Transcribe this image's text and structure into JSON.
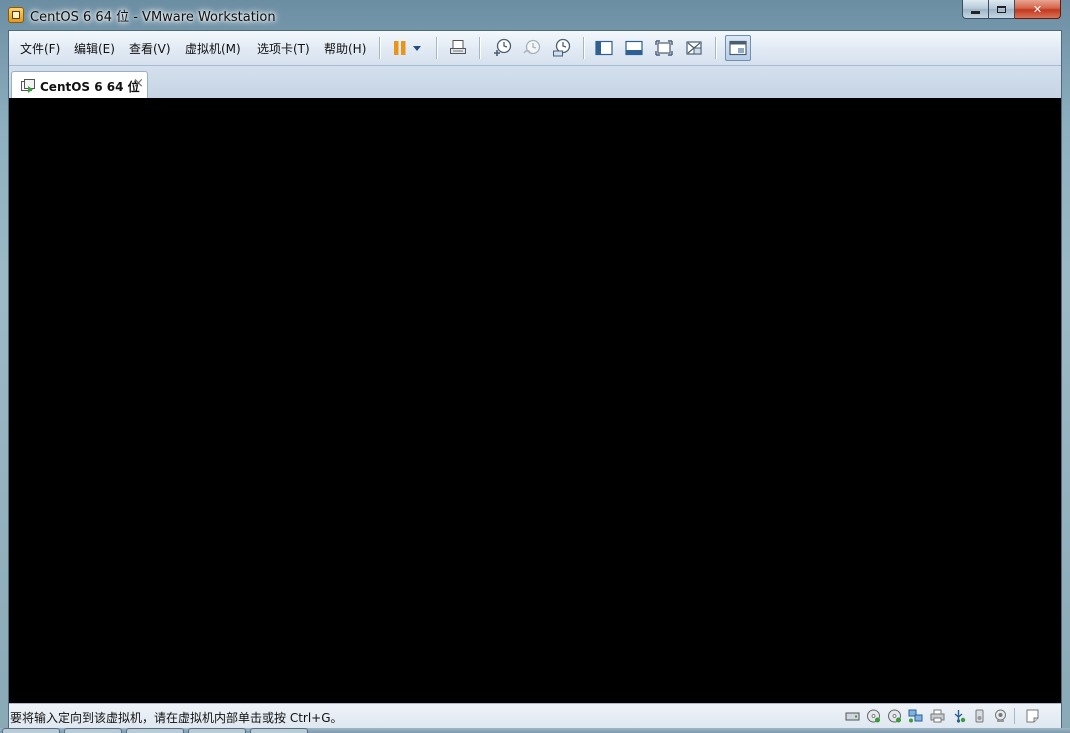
{
  "window": {
    "title": "CentOS 6 64 位 - VMware Workstation",
    "caption_buttons": [
      "minimize-icon",
      "maximize-icon",
      "close-icon"
    ],
    "close_glyph": "✕"
  },
  "menubar": {
    "items": [
      {
        "label": "文件(F)"
      },
      {
        "label": "编辑(E)"
      },
      {
        "label": "查看(V)"
      },
      {
        "label": "虚拟机(M)"
      },
      {
        "label": "选项卡(T)"
      },
      {
        "label": "帮助(H)"
      }
    ]
  },
  "toolbar": {
    "buttons": [
      {
        "icon": "pause-icon"
      },
      {
        "icon": "dropdown-arrow-icon"
      },
      {
        "icon": "send-ctrl-alt-del-icon"
      },
      {
        "icon": "take-snapshot-icon"
      },
      {
        "icon": "revert-snapshot-icon"
      },
      {
        "icon": "snapshot-manager-icon"
      },
      {
        "icon": "show-library-icon"
      },
      {
        "icon": "show-thumbnail-bar-icon"
      },
      {
        "icon": "full-screen-icon"
      },
      {
        "icon": "unity-icon"
      },
      {
        "icon": "console-view-icon"
      }
    ],
    "accent_color": "#e8951a"
  },
  "tabs": [
    {
      "label": "CentOS 6 64 位",
      "close": "×",
      "active": true
    }
  ],
  "vm_screen": {
    "background": "#000000"
  },
  "statusbar": {
    "message": "要将输入定向到该虚拟机，请在虚拟机内部单击或按 Ctrl+G。",
    "device_icons": [
      "hard-disk-icon",
      "cd-dvd-icon",
      "cd-dvd-2-icon",
      "network-adapter-icon",
      "printer-icon",
      "usb-icon",
      "sound-card-icon",
      "camera-icon",
      "message-log-icon"
    ]
  }
}
